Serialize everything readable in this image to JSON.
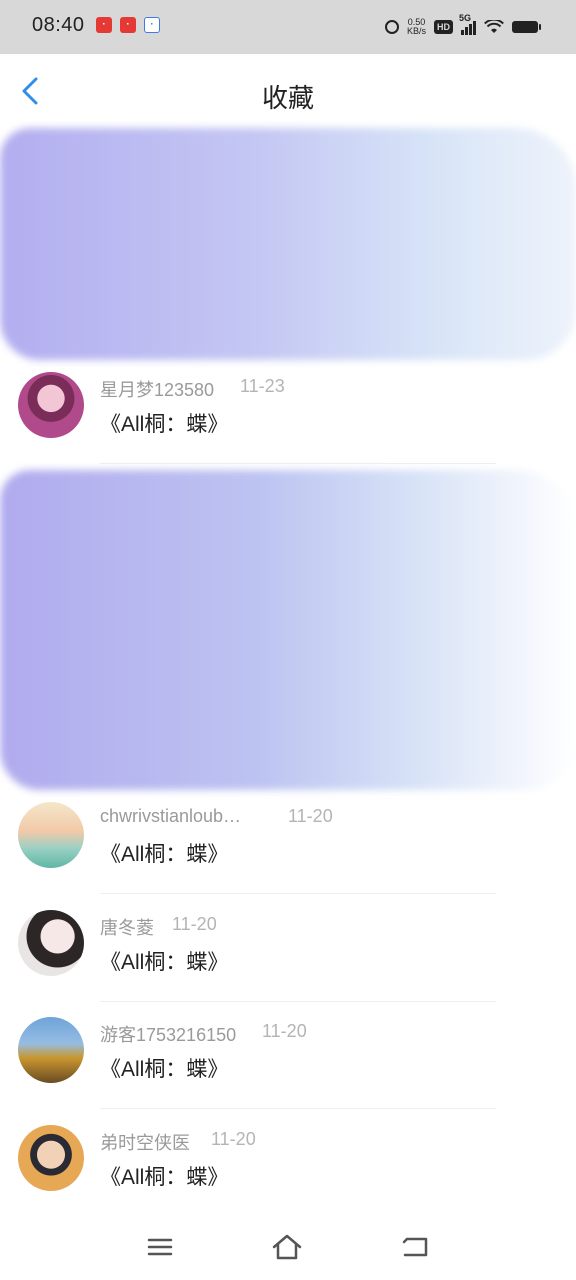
{
  "status_bar": {
    "time": "08:40",
    "app_icons": [
      "app-icon-red",
      "app-icon-listen",
      "app-icon-baidu"
    ],
    "net_speed_value": "0.50",
    "net_speed_unit": "KB/s",
    "hd_label": "HD",
    "network_label": "5G"
  },
  "header": {
    "title": "收藏",
    "back_icon": "chevron-left-icon",
    "accent_color": "#2f8ee8"
  },
  "list": {
    "items": [
      {
        "username": "星月梦123580",
        "date": "11-23",
        "title": "《All桐：蝶》"
      },
      {
        "username": "chwrivstianloub…",
        "date": "11-20",
        "title": "《All桐：蝶》"
      },
      {
        "username": "唐冬菱",
        "date": "11-20",
        "title": "《All桐：蝶》"
      },
      {
        "username": "游客1753216150",
        "date": "11-20",
        "title": "《All桐：蝶》"
      },
      {
        "username": "弟时空侠医",
        "date": "11-20",
        "title": "《All桐：蝶》"
      }
    ]
  },
  "nav_bar": {
    "icons": [
      "menu-icon",
      "home-icon",
      "back-icon"
    ]
  }
}
